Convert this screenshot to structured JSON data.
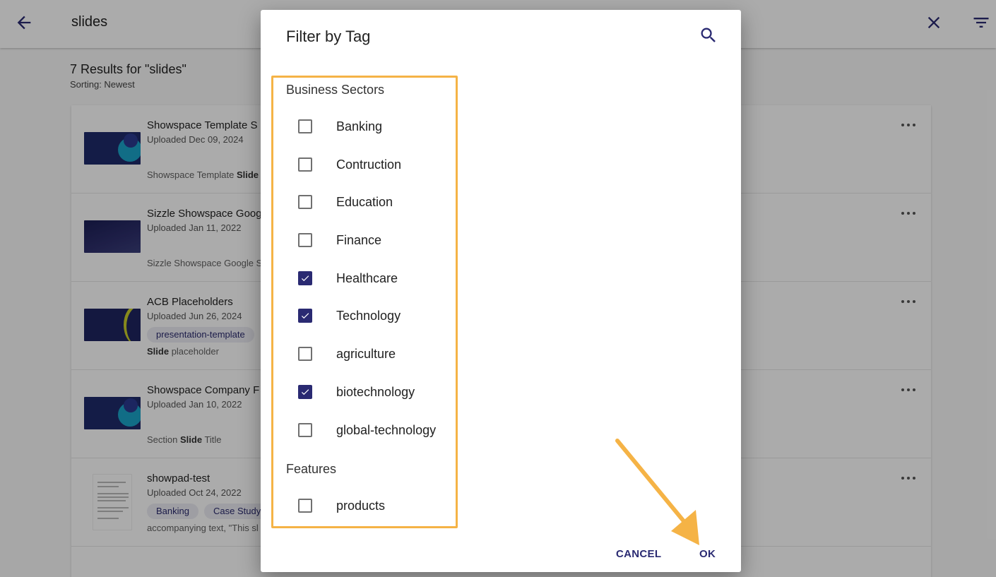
{
  "topbar": {
    "back_icon": "arrow-left-icon",
    "query": "slides",
    "close_icon": "close-icon",
    "filter_icon": "filter-icon"
  },
  "results": {
    "title": "7 Results for \"slides\"",
    "sorting": "Sorting: Newest"
  },
  "rows": [
    {
      "title": "Showspace Template S",
      "uploaded": "Uploaded Dec 09, 2024",
      "extra_pre": "Showspace Template ",
      "extra_bold": "Slide",
      "extra_post": ""
    },
    {
      "title": "Sizzle Showspace Goog",
      "uploaded": "Uploaded Jan 11, 2022",
      "extra_pre": "Sizzle Showspace Google S",
      "extra_bold": "",
      "extra_post": ""
    },
    {
      "title": "ACB Placeholders",
      "uploaded": "Uploaded Jun 26, 2024",
      "chip": "presentation-template",
      "extra_pre": "",
      "extra_bold": "Slide",
      "extra_post": " placeholder"
    },
    {
      "title": "Showspace Company F",
      "uploaded": "Uploaded Jan 10, 2022",
      "extra_pre": "Section ",
      "extra_bold": "Slide",
      "extra_post": " Title"
    },
    {
      "title": "showpad-test",
      "uploaded": "Uploaded Oct 24, 2022",
      "chips": [
        "Banking",
        "Case Study"
      ],
      "extra_pre": "accompanying text, \"This sl",
      "extra_bold": "",
      "extra_post": ""
    }
  ],
  "dialog": {
    "title": "Filter by Tag",
    "search_icon": "search-icon",
    "groups": [
      {
        "name": "Business Sectors",
        "options": [
          {
            "label": "Banking",
            "checked": false
          },
          {
            "label": "Contruction",
            "checked": false
          },
          {
            "label": "Education",
            "checked": false
          },
          {
            "label": "Finance",
            "checked": false
          },
          {
            "label": "Healthcare",
            "checked": true
          },
          {
            "label": "Technology",
            "checked": true
          },
          {
            "label": "agriculture",
            "checked": false
          },
          {
            "label": "biotechnology",
            "checked": true
          },
          {
            "label": "global-technology",
            "checked": false
          }
        ]
      },
      {
        "name": "Features",
        "options": [
          {
            "label": "products",
            "checked": false
          }
        ]
      }
    ],
    "cancel_label": "CANCEL",
    "ok_label": "OK"
  },
  "colors": {
    "accent": "#2a2a72",
    "highlight": "#f5b346"
  }
}
